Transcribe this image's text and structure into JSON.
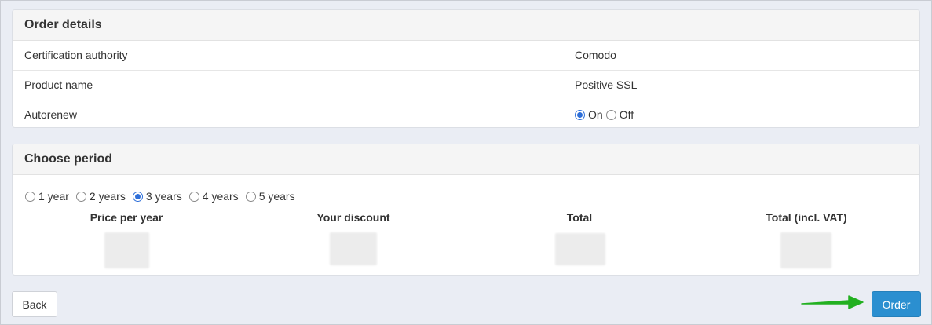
{
  "order_details": {
    "title": "Order details",
    "rows": [
      {
        "label": "Certification authority",
        "value": "Comodo"
      },
      {
        "label": "Product name",
        "value": "Positive SSL"
      }
    ],
    "autorenew": {
      "label": "Autorenew",
      "options": [
        {
          "label": "On",
          "selected": true
        },
        {
          "label": "Off",
          "selected": false
        }
      ]
    }
  },
  "choose_period": {
    "title": "Choose period",
    "options": [
      {
        "label": "1 year",
        "selected": false
      },
      {
        "label": "2 years",
        "selected": false
      },
      {
        "label": "3 years",
        "selected": true
      },
      {
        "label": "4 years",
        "selected": false
      },
      {
        "label": "5 years",
        "selected": false
      }
    ],
    "columns": [
      "Price per year",
      "Your discount",
      "Total",
      "Total (incl. VAT)"
    ]
  },
  "actions": {
    "back_label": "Back",
    "order_label": "Order"
  },
  "colors": {
    "accent": "#2b8fd0",
    "radio_selected": "#2e6fd9",
    "arrow": "#22b020"
  }
}
